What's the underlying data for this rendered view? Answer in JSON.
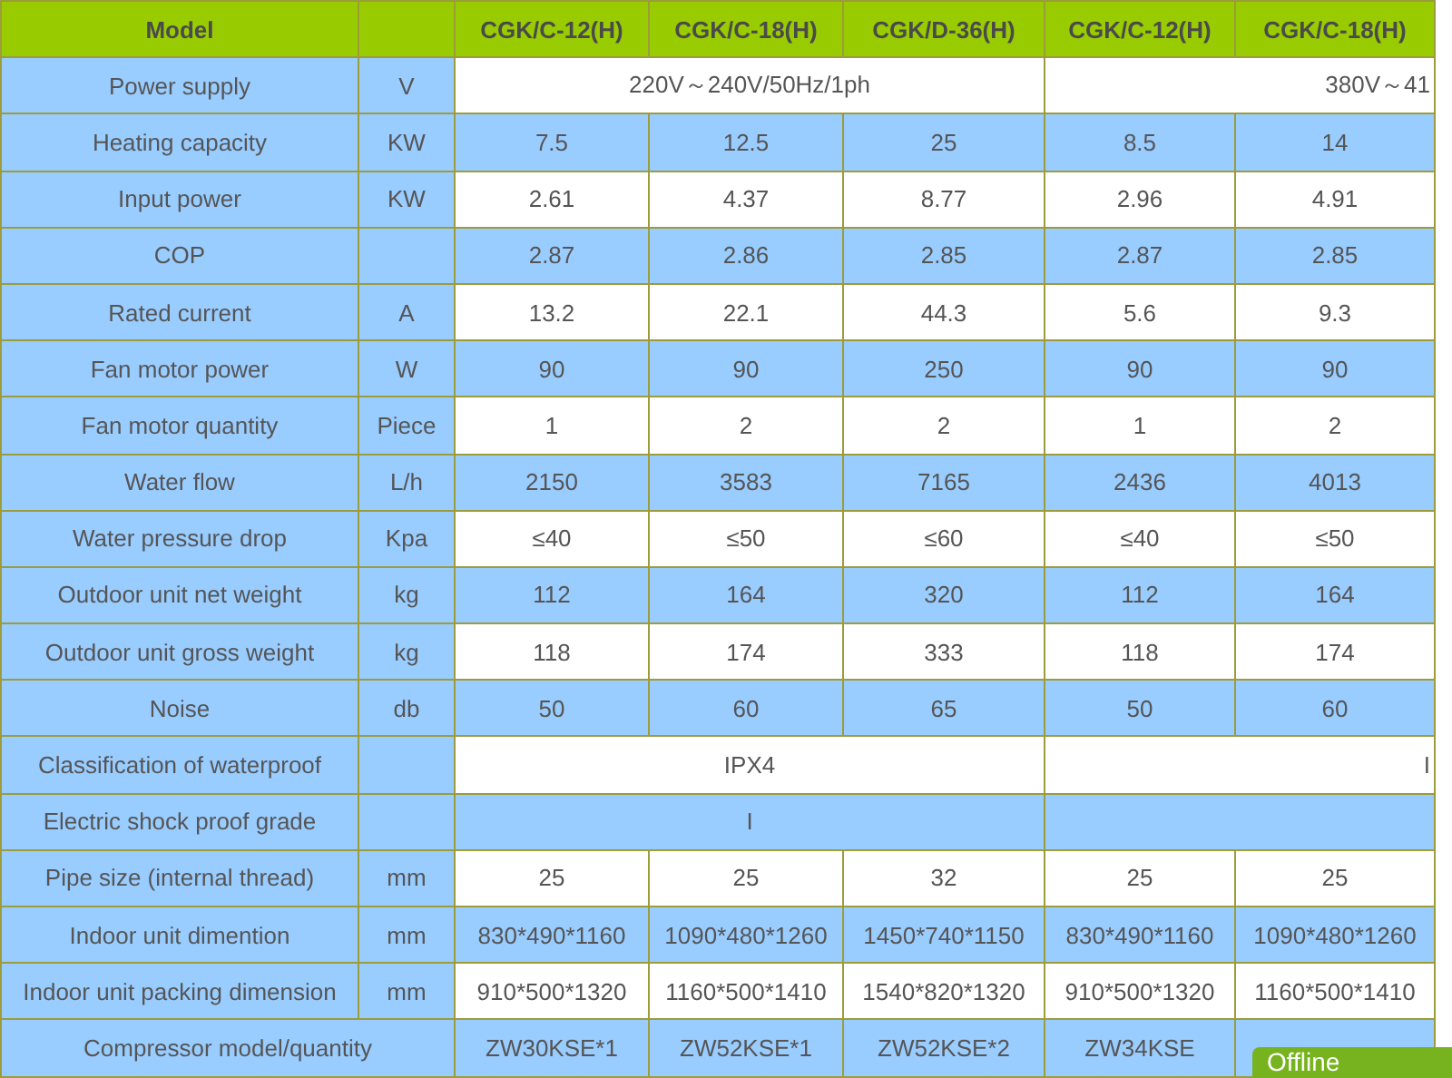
{
  "header": {
    "label": "Model",
    "models": [
      "CGK/C-12(H)",
      "CGK/C-18(H)",
      "CGK/D-36(H)",
      "CGK/C-12(H)",
      "CGK/C-18(H)"
    ]
  },
  "rows": [
    {
      "label": "Power supply",
      "unit": "V",
      "kind": "split",
      "cells": [
        {
          "text": "220V～240V/50Hz/1ph"
        },
        {
          "text": "380V～41"
        }
      ]
    },
    {
      "label": "Heating capacity",
      "unit": "KW",
      "cells": [
        {
          "text": "7.5"
        },
        {
          "text": "12.5"
        },
        {
          "text": "25"
        },
        {
          "text": "8.5"
        },
        {
          "text": "14"
        }
      ]
    },
    {
      "label": "Input power",
      "unit": "KW",
      "cells": [
        {
          "text": "2.61"
        },
        {
          "text": "4.37"
        },
        {
          "text": "8.77"
        },
        {
          "text": "2.96"
        },
        {
          "text": "4.91"
        }
      ]
    },
    {
      "label": "COP",
      "cells": [
        {
          "text": "2.87"
        },
        {
          "text": "2.86"
        },
        {
          "text": "2.85"
        },
        {
          "text": "2.87"
        },
        {
          "text": "2.85"
        }
      ]
    },
    {
      "label": "Rated current",
      "unit": "A",
      "cells": [
        {
          "text": "13.2"
        },
        {
          "text": "22.1"
        },
        {
          "text": "44.3"
        },
        {
          "text": "5.6"
        },
        {
          "text": "9.3"
        }
      ]
    },
    {
      "label": "Fan motor power",
      "unit": "W",
      "cells": [
        {
          "text": "90"
        },
        {
          "text": "90"
        },
        {
          "text": "250"
        },
        {
          "text": "90"
        },
        {
          "text": "90"
        }
      ]
    },
    {
      "label": "Fan motor quantity",
      "unit": "Piece",
      "cells": [
        {
          "text": "1"
        },
        {
          "text": "2"
        },
        {
          "text": "2"
        },
        {
          "text": "1"
        },
        {
          "text": "2"
        }
      ]
    },
    {
      "label": "Water flow",
      "unit": "L/h",
      "cells": [
        {
          "text": "2150"
        },
        {
          "text": "3583"
        },
        {
          "text": "7165"
        },
        {
          "text": "2436"
        },
        {
          "text": "4013"
        }
      ]
    },
    {
      "label": "Water pressure drop",
      "unit": "Kpa",
      "cells": [
        {
          "text": "≤40"
        },
        {
          "text": "≤50"
        },
        {
          "text": "≤60"
        },
        {
          "text": "≤40"
        },
        {
          "text": "≤50"
        }
      ]
    },
    {
      "label": "Outdoor unit net weight",
      "unit": "kg",
      "cells": [
        {
          "text": "112"
        },
        {
          "text": "164"
        },
        {
          "text": "320"
        },
        {
          "text": "112"
        },
        {
          "text": "164"
        }
      ]
    },
    {
      "label": "Outdoor unit gross weight",
      "unit": "kg",
      "cells": [
        {
          "text": "118"
        },
        {
          "text": "174"
        },
        {
          "text": "333"
        },
        {
          "text": "118"
        },
        {
          "text": "174"
        }
      ]
    },
    {
      "label": "Noise",
      "unit": "db",
      "cells": [
        {
          "text": "50"
        },
        {
          "text": "60"
        },
        {
          "text": "65"
        },
        {
          "text": "50"
        },
        {
          "text": "60"
        }
      ]
    },
    {
      "label": "Classification of waterproof",
      "kind": "split",
      "cells": [
        {
          "text": "IPX4"
        },
        {
          "text": "I"
        }
      ]
    },
    {
      "label": "Electric shock proof grade",
      "kind": "split",
      "cells": [
        {
          "text": "I"
        }
      ]
    },
    {
      "label": "Pipe size (internal thread)",
      "unit": "mm",
      "cells": [
        {
          "text": "25"
        },
        {
          "text": "25"
        },
        {
          "text": "32"
        },
        {
          "text": "25"
        },
        {
          "text": "25"
        }
      ]
    },
    {
      "label": "Indoor unit dimention",
      "unit": "mm",
      "cells": [
        {
          "text": "830*490*1160"
        },
        {
          "text": "1090*480*1260"
        },
        {
          "text": "1450*740*1150"
        },
        {
          "text": "830*490*1160"
        },
        {
          "text": "1090*480*1260"
        }
      ]
    },
    {
      "label": "Indoor unit packing dimension",
      "unit": "mm",
      "cells": [
        {
          "text": "910*500*1320"
        },
        {
          "text": "1160*500*1410"
        },
        {
          "text": "1540*820*1320"
        },
        {
          "text": "910*500*1320"
        },
        {
          "text": "1160*500*1410"
        }
      ]
    },
    {
      "label": "Compressor model/quantity",
      "kind": "wide",
      "cells": [
        {
          "text": "ZW30KSE*1"
        },
        {
          "text": "ZW52KSE*1"
        },
        {
          "text": "ZW52KSE*2"
        },
        {
          "text": "ZW34KSE"
        },
        {}
      ]
    }
  ],
  "chat_widget": {
    "label": "Offline"
  }
}
